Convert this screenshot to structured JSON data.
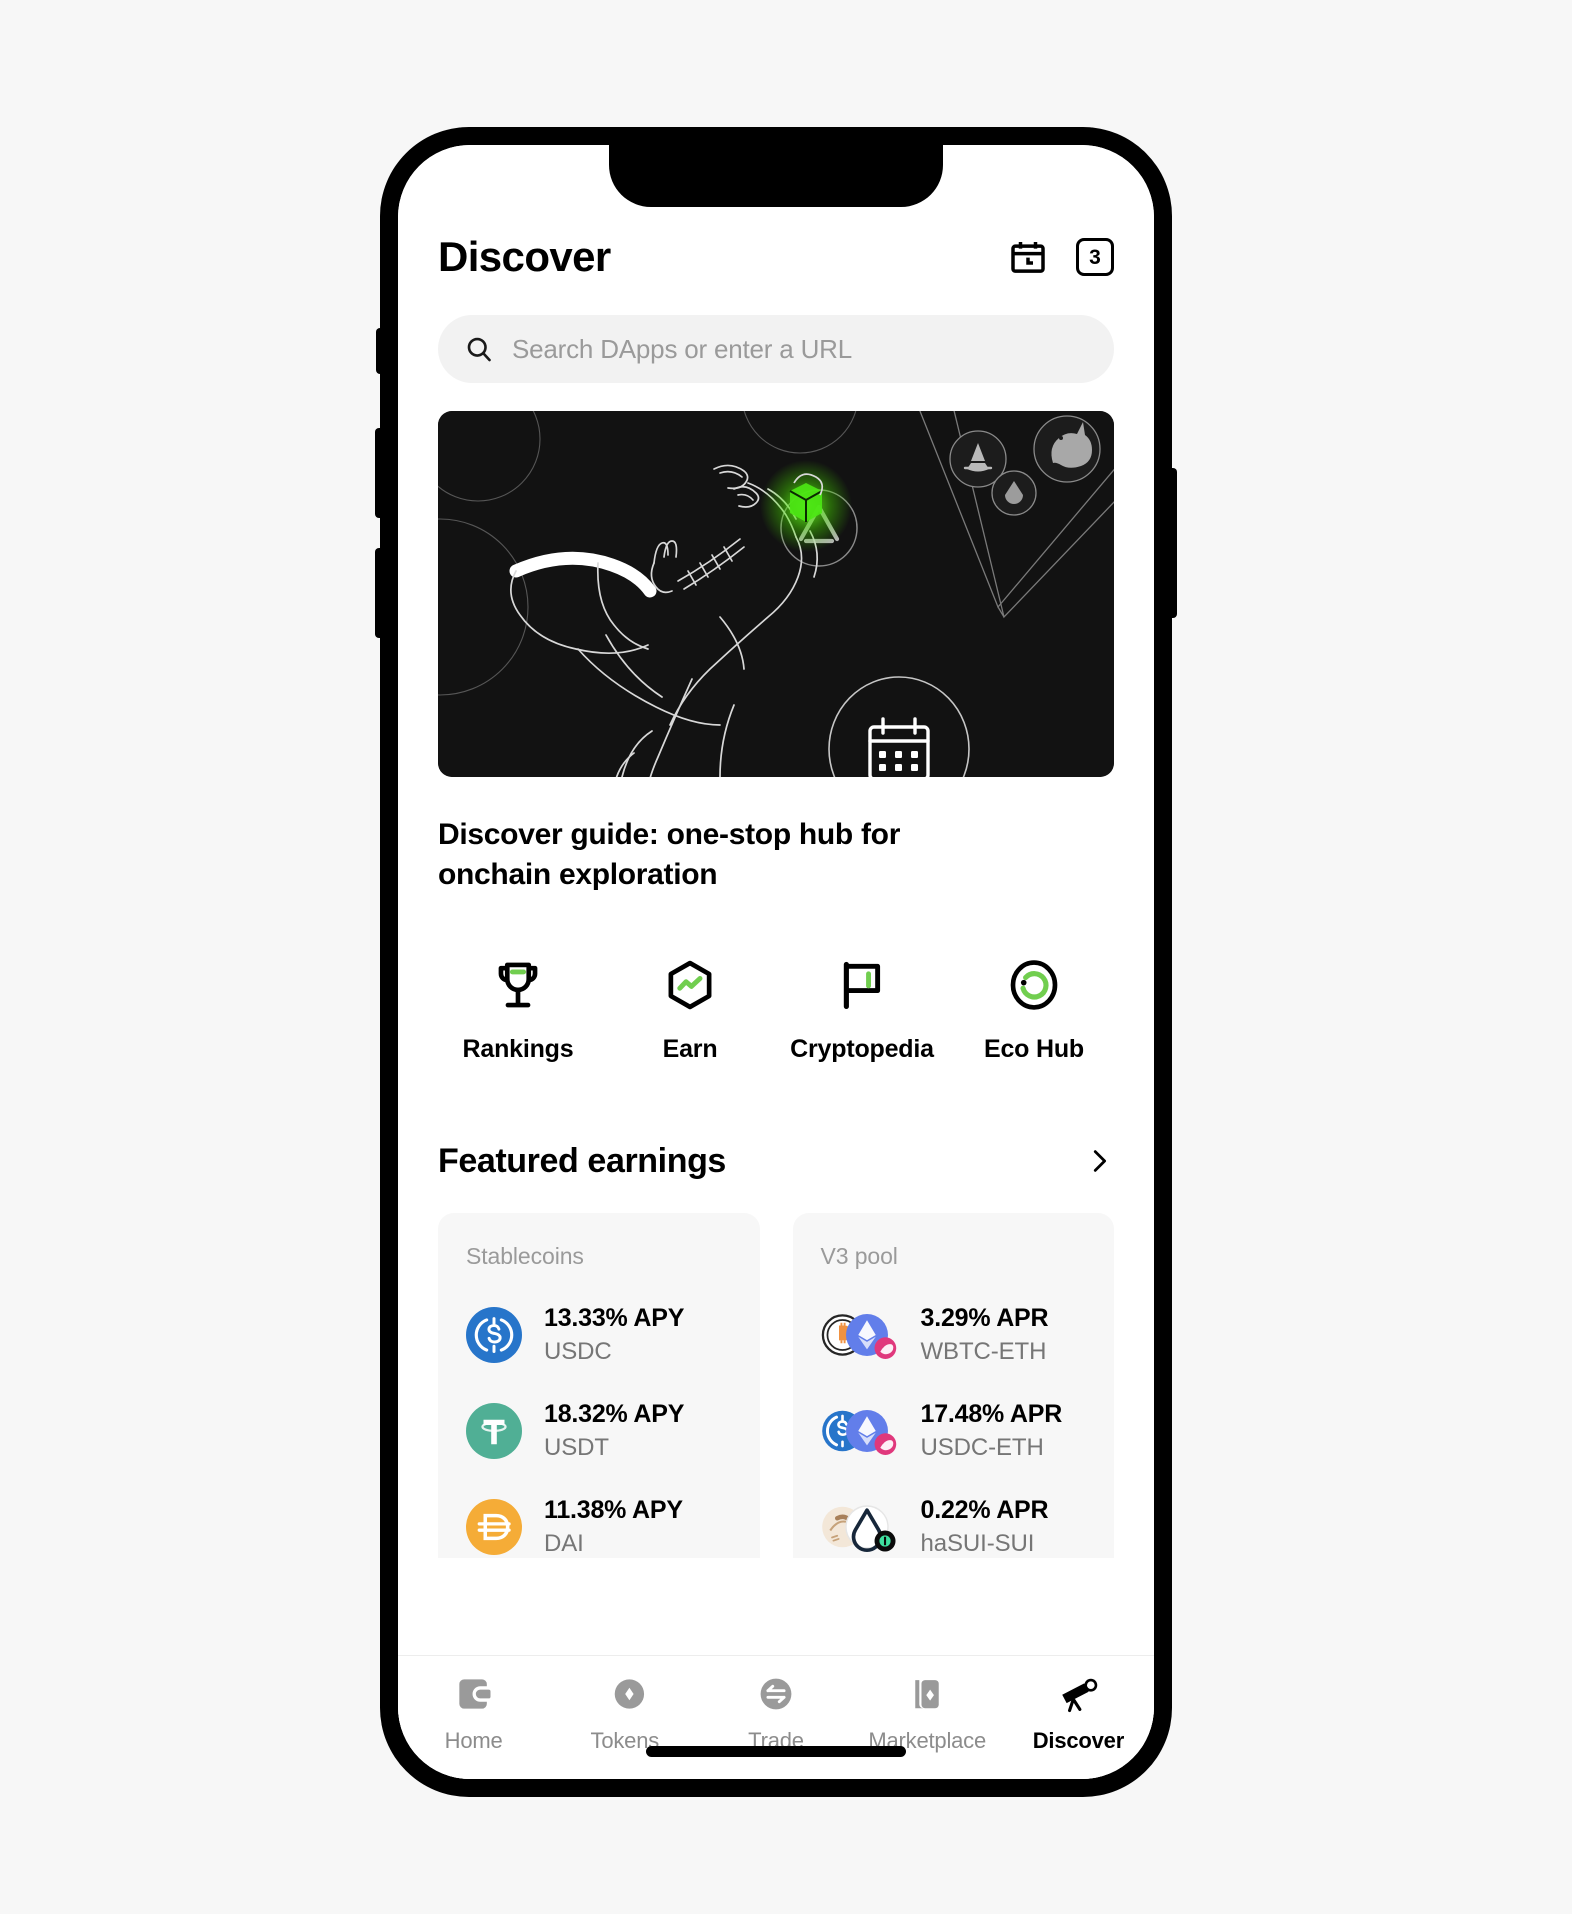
{
  "app": {
    "header": {
      "title": "Discover",
      "calendar_icon": "calendar-clock-icon",
      "tabs_count": "3"
    },
    "search": {
      "placeholder": "Search DApps or enter a URL",
      "value": "",
      "icon": "search-icon"
    },
    "banner": {
      "alt": "line-art figure reaching toward glowing green cube",
      "background": "#121212",
      "accent": "#4CE614",
      "icons": [
        "opensea-boat-icon",
        "uniswap-unicorn-icon",
        "droplet-icon",
        "app-store-icon",
        "calendar-icon"
      ]
    },
    "article": {
      "title": "Discover guide: one-stop hub for onchain exploration"
    },
    "quicklinks": [
      {
        "label": "Rankings",
        "icon": "trophy-icon"
      },
      {
        "label": "Earn",
        "icon": "hexagon-chart-icon"
      },
      {
        "label": "Cryptopedia",
        "icon": "flag-icon"
      },
      {
        "label": "Eco Hub",
        "icon": "circular-arrow-icon"
      }
    ],
    "featured_earnings": {
      "title": "Featured earnings",
      "chevron_icon": "chevron-right-icon",
      "cards": [
        {
          "title": "Stablecoins",
          "items": [
            {
              "rate": "13.33% APY",
              "pair": "USDC",
              "logo": "usdc-icon"
            },
            {
              "rate": "18.32% APY",
              "pair": "USDT",
              "logo": "usdt-icon"
            },
            {
              "rate": "11.38% APY",
              "pair": "DAI",
              "logo": "dai-icon"
            }
          ]
        },
        {
          "title": "V3 pool",
          "items": [
            {
              "rate": "3.29% APR",
              "pair": "WBTC-ETH",
              "logo": "wbtc-eth-uniswap-icon"
            },
            {
              "rate": "17.48% APR",
              "pair": "USDC-ETH",
              "logo": "usdc-eth-uniswap-icon"
            },
            {
              "rate": "0.22% APR",
              "pair": "haSUI-SUI",
              "logo": "hasui-sui-icon"
            }
          ]
        }
      ]
    },
    "tabbar": {
      "active": "Discover",
      "items": [
        {
          "label": "Home",
          "icon": "wallet-icon"
        },
        {
          "label": "Tokens",
          "icon": "coins-icon"
        },
        {
          "label": "Trade",
          "icon": "swap-icon"
        },
        {
          "label": "Marketplace",
          "icon": "cards-icon"
        },
        {
          "label": "Discover",
          "icon": "telescope-icon"
        }
      ]
    }
  },
  "colors": {
    "accent_green": "#71CE4F",
    "banner_bg": "#121212",
    "card_bg": "#F7F7F7",
    "search_bg": "#F2F2F2",
    "muted_text": "#9A9A9A"
  }
}
